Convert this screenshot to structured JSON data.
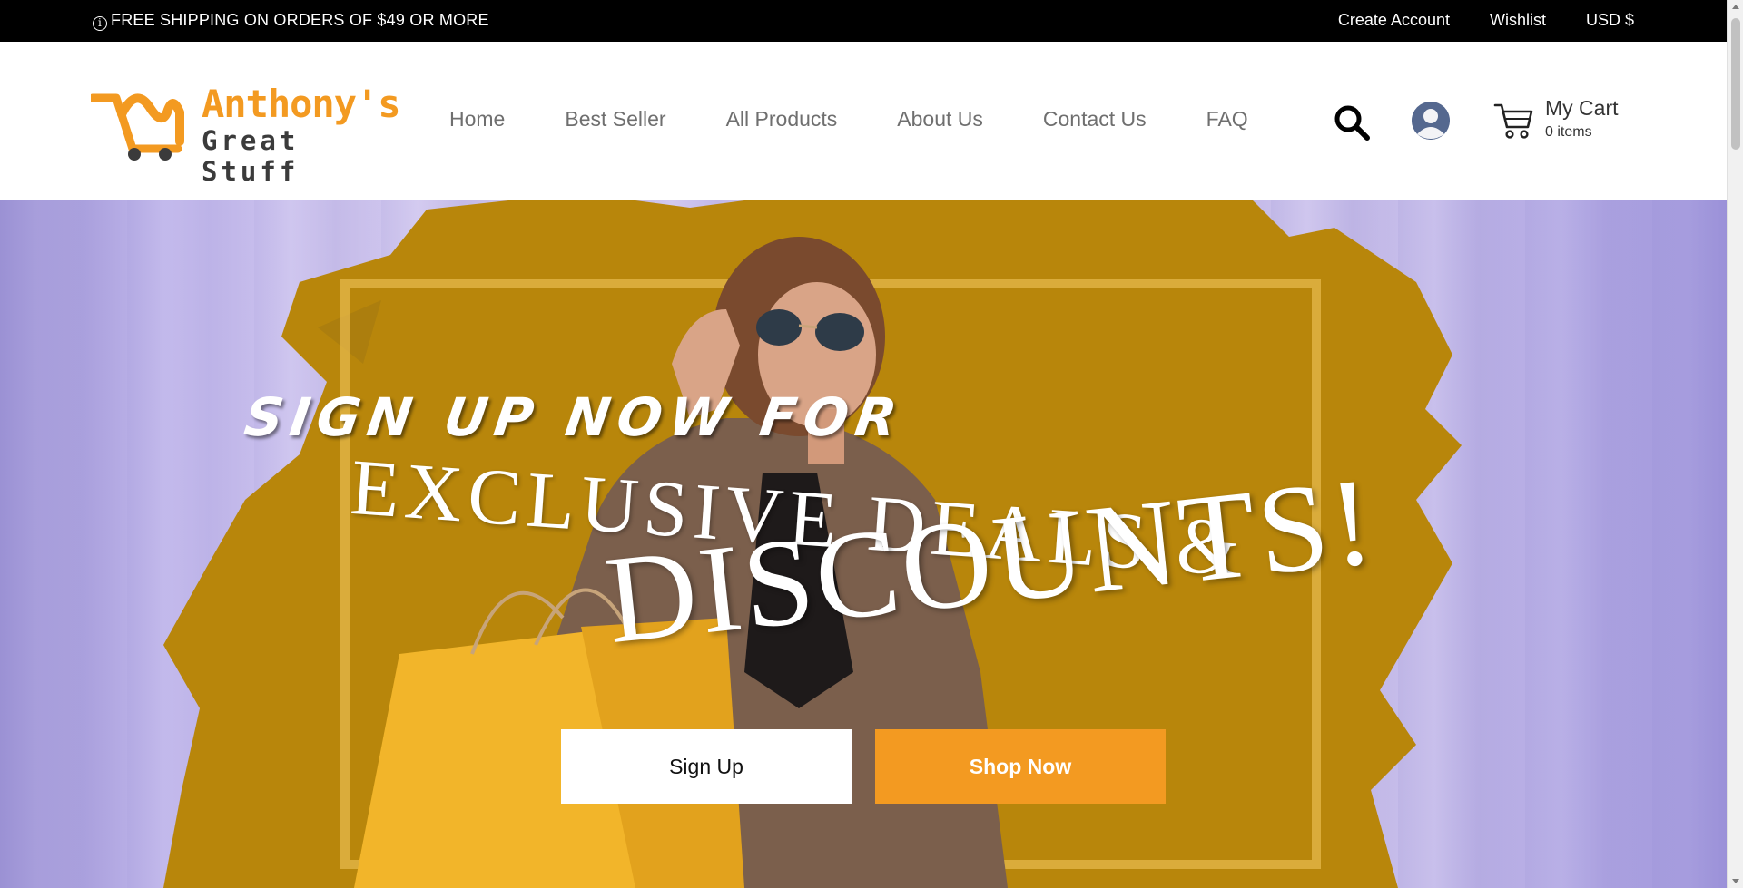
{
  "topbar": {
    "shipping_text": "FREE SHIPPING ON ORDERS OF $49 OR MORE",
    "info_glyph": "i",
    "links": [
      "Create Account",
      "Wishlist",
      "USD $"
    ]
  },
  "header": {
    "logo": {
      "line1": "Anthony's",
      "line2": "Great Stuff",
      "icon": "hand-truck-icon"
    },
    "nav": [
      "Home",
      "Best Seller",
      "All Products",
      "About Us",
      "Contact Us",
      "FAQ"
    ],
    "cart": {
      "title": "My Cart",
      "count": "0 items"
    },
    "icons": [
      "search-icon",
      "user-avatar-icon",
      "cart-icon"
    ]
  },
  "hero": {
    "line1": "SIGN UP NOW FOR",
    "line2": "EXCLUSIVE DEALS &",
    "line3": "DISCOUNTS!",
    "buttons": {
      "signup": "Sign Up",
      "shop": "Shop Now"
    }
  },
  "colors": {
    "accent": "#f39a21",
    "topbar_bg": "#000000",
    "splash": "#b8860b",
    "hero_tint": "#b6aee0"
  }
}
